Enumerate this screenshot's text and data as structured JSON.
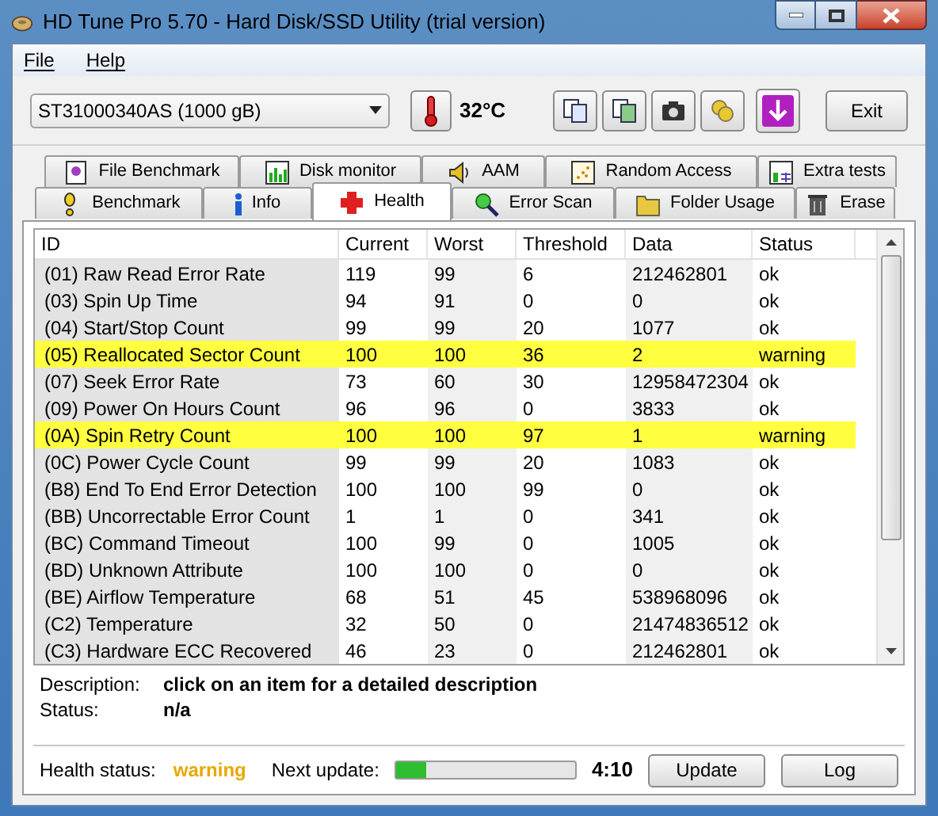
{
  "window": {
    "title": "HD Tune Pro 5.70 - Hard Disk/SSD Utility (trial version)"
  },
  "menu": [
    "File",
    "Help"
  ],
  "drive_select": {
    "value": "ST31000340AS (1000 gB)"
  },
  "temperature": "32°C",
  "exit_button": "Exit",
  "tab_rows": [
    [
      {
        "label": "File Benchmark",
        "selected": false
      },
      {
        "label": "Disk monitor",
        "selected": false
      },
      {
        "label": "AAM",
        "selected": false
      },
      {
        "label": "Random Access",
        "selected": false
      },
      {
        "label": "Extra tests",
        "selected": false
      }
    ],
    [
      {
        "label": "Benchmark",
        "selected": false
      },
      {
        "label": "Info",
        "selected": false
      },
      {
        "label": "Health",
        "selected": true
      },
      {
        "label": "Error Scan",
        "selected": false
      },
      {
        "label": "Folder Usage",
        "selected": false
      },
      {
        "label": "Erase",
        "selected": false
      }
    ]
  ],
  "table": {
    "columns": [
      "ID",
      "Current",
      "Worst",
      "Threshold",
      "Data",
      "Status"
    ],
    "rows": [
      {
        "cells": [
          "(01) Raw Read Error Rate",
          "119",
          "99",
          "6",
          "212462801",
          "ok"
        ],
        "highlighted": false
      },
      {
        "cells": [
          "(03) Spin Up Time",
          "94",
          "91",
          "0",
          "0",
          "ok"
        ],
        "highlighted": false
      },
      {
        "cells": [
          "(04) Start/Stop Count",
          "99",
          "99",
          "20",
          "1077",
          "ok"
        ],
        "highlighted": false
      },
      {
        "cells": [
          "(05) Reallocated Sector Count",
          "100",
          "100",
          "36",
          "2",
          "warning"
        ],
        "highlighted": true
      },
      {
        "cells": [
          "(07) Seek Error Rate",
          "73",
          "60",
          "30",
          "12958472304",
          "ok"
        ],
        "highlighted": false
      },
      {
        "cells": [
          "(09) Power On Hours Count",
          "96",
          "96",
          "0",
          "3833",
          "ok"
        ],
        "highlighted": false
      },
      {
        "cells": [
          "(0A) Spin Retry Count",
          "100",
          "100",
          "97",
          "1",
          "warning"
        ],
        "highlighted": true
      },
      {
        "cells": [
          "(0C) Power Cycle Count",
          "99",
          "99",
          "20",
          "1083",
          "ok"
        ],
        "highlighted": false
      },
      {
        "cells": [
          "(B8) End To End Error Detection",
          "100",
          "100",
          "99",
          "0",
          "ok"
        ],
        "highlighted": false
      },
      {
        "cells": [
          "(BB) Uncorrectable Error Count",
          "1",
          "1",
          "0",
          "341",
          "ok"
        ],
        "highlighted": false
      },
      {
        "cells": [
          "(BC) Command Timeout",
          "100",
          "99",
          "0",
          "1005",
          "ok"
        ],
        "highlighted": false
      },
      {
        "cells": [
          "(BD) Unknown Attribute",
          "100",
          "100",
          "0",
          "0",
          "ok"
        ],
        "highlighted": false
      },
      {
        "cells": [
          "(BE) Airflow Temperature",
          "68",
          "51",
          "45",
          "538968096",
          "ok"
        ],
        "highlighted": false
      },
      {
        "cells": [
          "(C2) Temperature",
          "32",
          "50",
          "0",
          "21474836512",
          "ok"
        ],
        "highlighted": false
      },
      {
        "cells": [
          "(C3) Hardware ECC Recovered",
          "46",
          "23",
          "0",
          "212462801",
          "ok"
        ],
        "highlighted": false
      }
    ]
  },
  "details": [
    {
      "label": "Description:",
      "value": "click on an item for a detailed description"
    },
    {
      "label": "Status:",
      "value": "n/a"
    }
  ],
  "footer": {
    "health_label": "Health status:",
    "health_value": "warning",
    "next_update_label": "Next update:",
    "level": 0.16,
    "countdown": "4:10",
    "buttons": [
      "Update",
      "Log"
    ]
  }
}
